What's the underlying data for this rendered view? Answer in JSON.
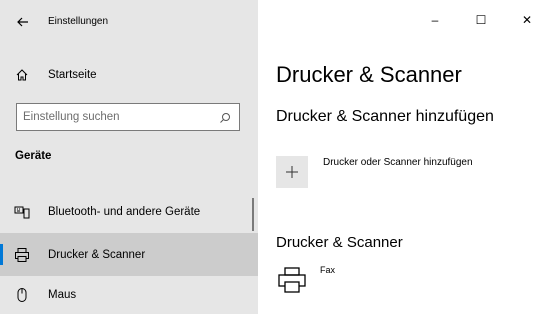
{
  "window": {
    "title": "Einstellungen",
    "controls": {
      "minimize": "–",
      "maximize": "☐",
      "close": "✕"
    }
  },
  "sidebar": {
    "home_label": "Startseite",
    "search_placeholder": "Einstellung suchen",
    "section_title": "Geräte",
    "items": [
      {
        "label": "Bluetooth- und andere Geräte",
        "icon": "keyboard-icon"
      },
      {
        "label": "Drucker & Scanner",
        "icon": "printer-icon",
        "selected": true
      },
      {
        "label": "Maus",
        "icon": "mouse-icon"
      }
    ]
  },
  "main": {
    "title": "Drucker & Scanner",
    "add_section_title": "Drucker & Scanner hinzufügen",
    "add_button_label": "Drucker oder Scanner hinzufügen",
    "list_section_title": "Drucker & Scanner",
    "devices": [
      {
        "name": "Fax",
        "icon": "printer-icon"
      }
    ]
  },
  "colors": {
    "accent": "#0078d7",
    "sidebar_bg": "#e6e6e6",
    "selected_bg": "#cccccc"
  }
}
